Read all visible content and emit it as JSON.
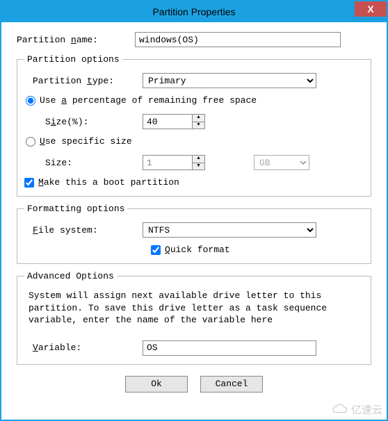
{
  "window": {
    "title": "Partition Properties",
    "close": "X"
  },
  "partition_name": {
    "label": "Partition name:",
    "accel": "n",
    "value": "windows(OS)"
  },
  "partition_options": {
    "legend": "Partition options",
    "type": {
      "label": "Partition type:",
      "accel": "t",
      "value": "Primary"
    },
    "use_percent": {
      "label": "Use a percentage of remaining free space",
      "accel": "a",
      "checked": true,
      "size_label": "Size(%):",
      "size_accel": "i",
      "value": "40"
    },
    "use_specific": {
      "label": "Use specific size",
      "accel": "U",
      "checked": false,
      "size_label": "Size:",
      "value": "1",
      "unit": "GB"
    },
    "boot": {
      "label": "Make this a boot partition",
      "accel": "M",
      "checked": true
    }
  },
  "formatting_options": {
    "legend": "Formatting options",
    "file_system": {
      "label": "File system:",
      "accel": "F",
      "value": "NTFS"
    },
    "quick_format": {
      "label": "Quick format",
      "accel": "Q",
      "checked": true
    }
  },
  "advanced_options": {
    "legend": "Advanced Options",
    "text": "System will assign next available drive letter to this partition. To save this drive letter as a task sequence variable, enter the name of the variable here",
    "variable": {
      "label": "Variable:",
      "accel": "V",
      "value": "OS"
    }
  },
  "buttons": {
    "ok": "Ok",
    "cancel": "Cancel"
  },
  "watermark": "亿速云"
}
